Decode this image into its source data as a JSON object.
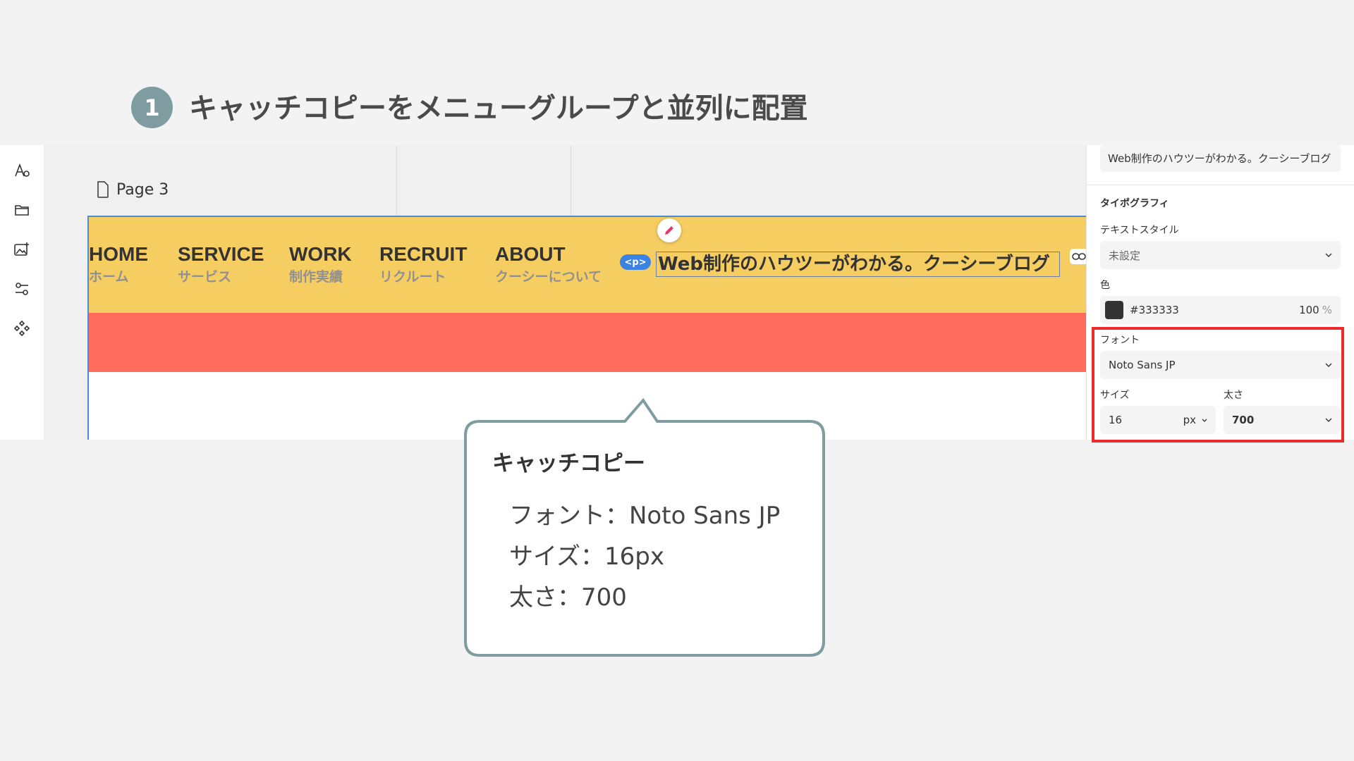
{
  "step": {
    "number": "1",
    "title": "キャッチコピーをメニューグループと並列に配置"
  },
  "canvas": {
    "page_label": "Page 3",
    "nav": [
      {
        "en": "HOME",
        "jp": "ホーム"
      },
      {
        "en": "SERVICE",
        "jp": "サービス"
      },
      {
        "en": "WORK",
        "jp": "制作実績"
      },
      {
        "en": "RECRUIT",
        "jp": "リクルート"
      },
      {
        "en": "ABOUT",
        "jp": "クーシーについて"
      }
    ],
    "tag_label": "<p>",
    "catch_copy": "Web制作のハウツーがわかる。クーシーブログ"
  },
  "panel": {
    "text_content": "Web制作のハウツーがわかる。クーシーブログ",
    "typography_heading": "タイポグラフィ",
    "text_style_label": "テキストスタイル",
    "text_style_value": "未設定",
    "color_label": "色",
    "color_value": "#333333",
    "color_opacity": "100",
    "opacity_unit": "%",
    "font_label": "フォント",
    "font_value": "Noto Sans JP",
    "size_label": "サイズ",
    "size_value": "16",
    "size_unit": "px",
    "weight_label": "太さ",
    "weight_value": "700"
  },
  "callout": {
    "title": "キャッチコピー",
    "lines": [
      "フォント：Noto Sans JP",
      "サイズ：16px",
      "太さ：700"
    ]
  },
  "colors": {
    "header_band": "#f6cd61",
    "red_band": "#ff6b5c",
    "highlight": "#ee2a2a",
    "selection": "#4a8bdb",
    "swatch": "#333333"
  }
}
